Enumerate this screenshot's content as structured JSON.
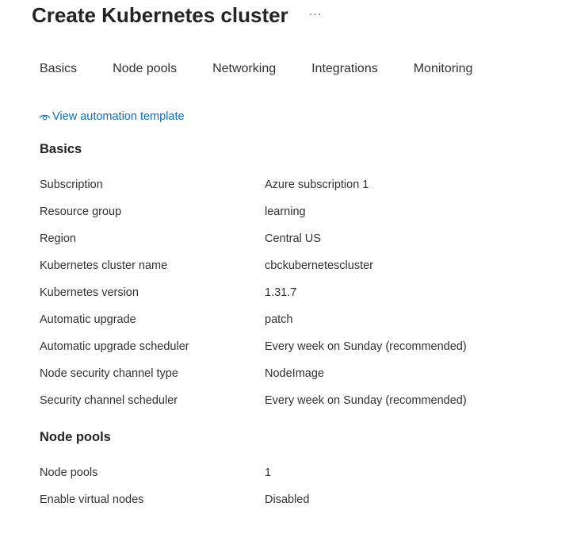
{
  "header": {
    "title": "Create Kubernetes cluster",
    "more_label": "···"
  },
  "tabs": [
    {
      "label": "Basics"
    },
    {
      "label": "Node pools"
    },
    {
      "label": "Networking"
    },
    {
      "label": "Integrations"
    },
    {
      "label": "Monitoring"
    }
  ],
  "automation_link": {
    "label": "View automation template",
    "icon": "eye-icon",
    "color": "#0f6cbd"
  },
  "sections": {
    "basics": {
      "heading": "Basics",
      "rows": [
        {
          "label": "Subscription",
          "value": "Azure subscription 1"
        },
        {
          "label": "Resource group",
          "value": "learning"
        },
        {
          "label": "Region",
          "value": "Central US"
        },
        {
          "label": "Kubernetes cluster name",
          "value": "cbckubernetescluster"
        },
        {
          "label": "Kubernetes version",
          "value": "1.31.7"
        },
        {
          "label": "Automatic upgrade",
          "value": "patch"
        },
        {
          "label": "Automatic upgrade scheduler",
          "value": "Every week on Sunday (recommended)"
        },
        {
          "label": "Node security channel type",
          "value": "NodeImage"
        },
        {
          "label": "Security channel scheduler",
          "value": "Every week on Sunday (recommended)"
        }
      ]
    },
    "node_pools": {
      "heading": "Node pools",
      "rows": [
        {
          "label": "Node pools",
          "value": "1"
        },
        {
          "label": "Enable virtual nodes",
          "value": "Disabled"
        }
      ]
    }
  }
}
